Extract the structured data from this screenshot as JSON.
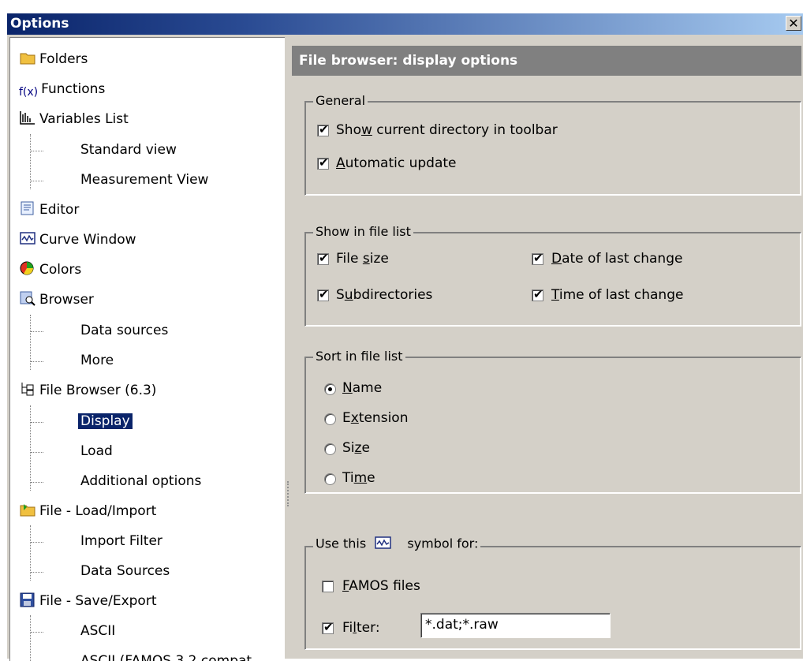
{
  "window": {
    "title": "Options",
    "close_glyph": "✕"
  },
  "tree": {
    "items": [
      {
        "label": "Folders",
        "icon": "folder-icon"
      },
      {
        "label": "Functions",
        "icon": "function-icon"
      },
      {
        "label": "Variables List",
        "icon": "variables-list-icon"
      },
      {
        "label": "Standard view"
      },
      {
        "label": "Measurement View"
      },
      {
        "label": "Editor",
        "icon": "editor-icon"
      },
      {
        "label": "Curve Window",
        "icon": "curve-window-icon"
      },
      {
        "label": "Colors",
        "icon": "colors-icon"
      },
      {
        "label": "Browser",
        "icon": "browser-icon"
      },
      {
        "label": "Data sources"
      },
      {
        "label": "More"
      },
      {
        "label": "File Browser (6.3)",
        "icon": "file-browser-icon"
      },
      {
        "label": "Display",
        "selected": true
      },
      {
        "label": "Load"
      },
      {
        "label": "Additional options"
      },
      {
        "label": "File - Load/Import",
        "icon": "load-import-icon"
      },
      {
        "label": "Import Filter"
      },
      {
        "label": "Data Sources"
      },
      {
        "label": "File - Save/Export",
        "icon": "save-export-icon"
      },
      {
        "label": "ASCII"
      },
      {
        "label": "ASCII (FAMOS 3.2 compat"
      }
    ]
  },
  "panel": {
    "header": "File browser: display options",
    "general": {
      "legend": "General",
      "show_dir_pre": "Sho",
      "show_dir_u": "w",
      "show_dir_post": " current directory in toolbar",
      "auto_u": "A",
      "auto_post": "utomatic update"
    },
    "show_list": {
      "legend": "Show in file list",
      "size_pre": "File ",
      "size_u": "s",
      "size_post": "ize",
      "sub_pre": "S",
      "sub_u": "u",
      "sub_post": "bdirectories",
      "date_u": "D",
      "date_post": "ate of last change",
      "time_u": "T",
      "time_post": "ime of last change"
    },
    "sort_list": {
      "legend": "Sort in file list",
      "name_u": "N",
      "name_post": "ame",
      "ext_pre": "E",
      "ext_u": "x",
      "ext_post": "tension",
      "size_pre": "Si",
      "size_u": "z",
      "size_post": "e",
      "time_pre": "Ti",
      "time_u": "m",
      "time_post": "e",
      "selected": "Name"
    },
    "symbol": {
      "legend_pre": "Use this",
      "legend_post": "symbol for:",
      "famos_u": "F",
      "famos_post": "AMOS files",
      "filter_pre": "Fi",
      "filter_u": "l",
      "filter_post": "ter:",
      "filter_value": "*.dat;*.raw"
    }
  }
}
